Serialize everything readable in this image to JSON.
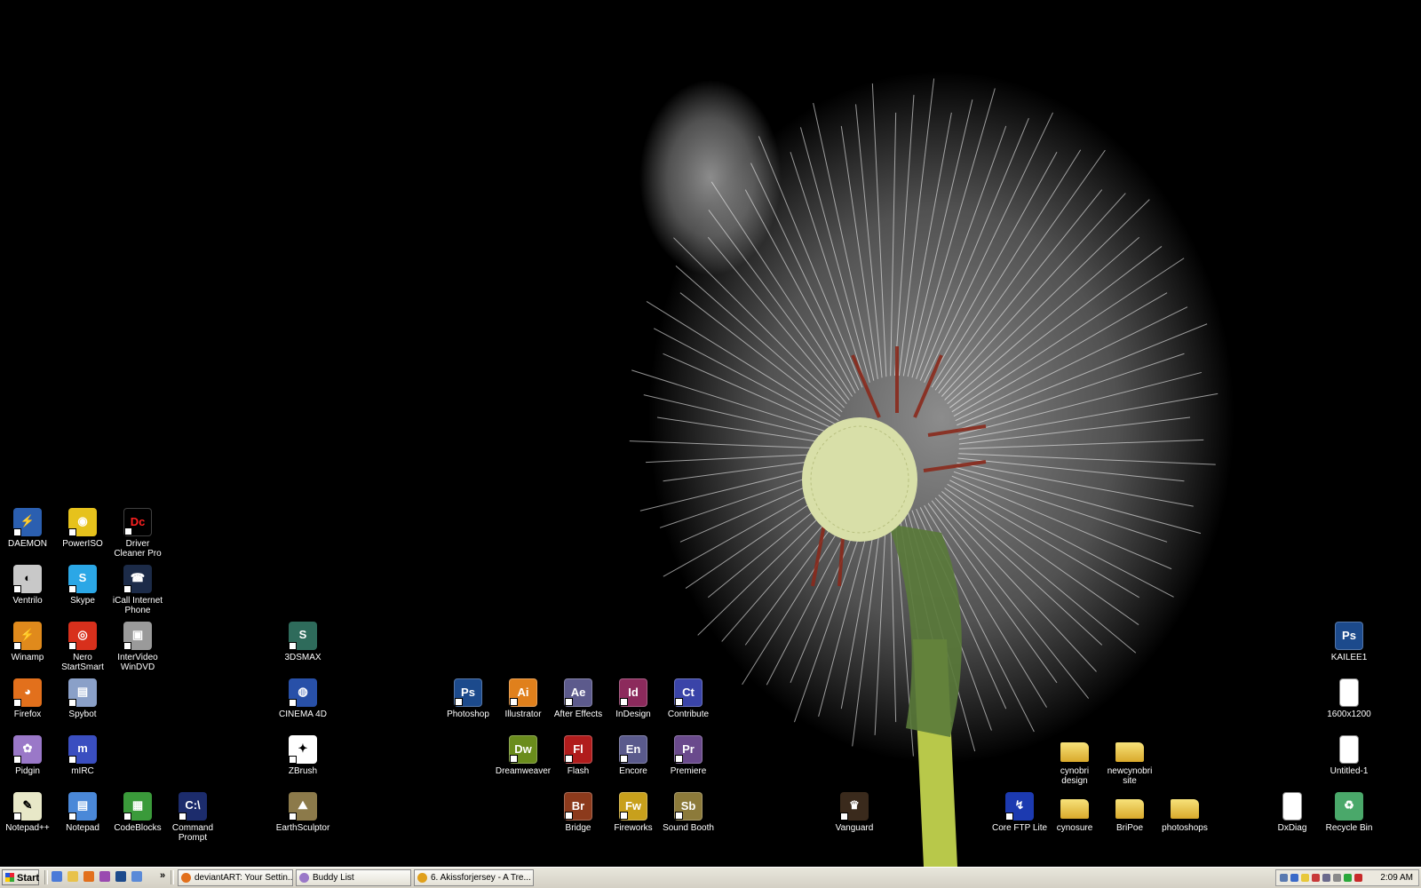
{
  "desktop": {
    "icons": [
      {
        "label": "DAEMON",
        "icon": "daemon-tools-icon",
        "bg": "#2b5fb0",
        "glyph": "⚡"
      },
      {
        "label": "PowerISO",
        "icon": "poweriso-icon",
        "bg": "#e6c21c",
        "glyph": "◉"
      },
      {
        "label": "Driver Cleaner Pro",
        "icon": "driver-cleaner-icon",
        "bg": "#000000",
        "glyph": "Dc"
      },
      {
        "label": "Ventrilo",
        "icon": "ventrilo-icon",
        "bg": "#c8c8c8",
        "glyph": "◐"
      },
      {
        "label": "Skype",
        "icon": "skype-icon",
        "bg": "#2ba7e6",
        "glyph": "S"
      },
      {
        "label": "iCall Internet Phone",
        "icon": "icall-icon",
        "bg": "#1c2b48",
        "glyph": "☎"
      },
      {
        "label": "Winamp",
        "icon": "winamp-icon",
        "bg": "#e08a1c",
        "glyph": "⚡"
      },
      {
        "label": "Nero StartSmart",
        "icon": "nero-icon",
        "bg": "#d8301c",
        "glyph": "◎"
      },
      {
        "label": "InterVideo WinDVD",
        "icon": "windvd-icon",
        "bg": "#9a9a9a",
        "glyph": "▣"
      },
      {
        "label": "3DSMAX",
        "icon": "3dsmax-icon",
        "bg": "#2e6b5b",
        "glyph": "S"
      },
      {
        "label": "Firefox",
        "icon": "firefox-icon",
        "bg": "#e2701c",
        "glyph": "◕"
      },
      {
        "label": "Spybot",
        "icon": "spybot-icon",
        "bg": "#8aa0c8",
        "glyph": "▤"
      },
      {
        "label": "CINEMA 4D",
        "icon": "cinema4d-icon",
        "bg": "#2850a8",
        "glyph": "◍"
      },
      {
        "label": "Pidgin",
        "icon": "pidgin-icon",
        "bg": "#9a78c8",
        "glyph": "✿"
      },
      {
        "label": "mIRC",
        "icon": "mirc-icon",
        "bg": "#3a4ec0",
        "glyph": "m"
      },
      {
        "label": "ZBrush",
        "icon": "zbrush-icon",
        "bg": "#ffffff",
        "glyph": "✦"
      },
      {
        "label": "Photoshop",
        "icon": "photoshop-icon",
        "bg": "#1c4a8c",
        "glyph": "Ps"
      },
      {
        "label": "Illustrator",
        "icon": "illustrator-icon",
        "bg": "#e0801c",
        "glyph": "Ai"
      },
      {
        "label": "After Effects",
        "icon": "after-effects-icon",
        "bg": "#5c5a8c",
        "glyph": "Ae"
      },
      {
        "label": "InDesign",
        "icon": "indesign-icon",
        "bg": "#8c2a5c",
        "glyph": "Id"
      },
      {
        "label": "Contribute",
        "icon": "contribute-icon",
        "bg": "#3a44a8",
        "glyph": "Ct"
      },
      {
        "label": "Dreamweaver",
        "icon": "dreamweaver-icon",
        "bg": "#6a8c1c",
        "glyph": "Dw"
      },
      {
        "label": "Flash",
        "icon": "flash-icon",
        "bg": "#b01c1c",
        "glyph": "Fl"
      },
      {
        "label": "Encore",
        "icon": "encore-icon",
        "bg": "#5a5a8c",
        "glyph": "En"
      },
      {
        "label": "Premiere",
        "icon": "premiere-icon",
        "bg": "#6a4a8c",
        "glyph": "Pr"
      },
      {
        "label": "Notepad++",
        "icon": "notepadpp-icon",
        "bg": "#e8e8c8",
        "glyph": "✎"
      },
      {
        "label": "Notepad",
        "icon": "notepad-icon",
        "bg": "#4a88d8",
        "glyph": "▤"
      },
      {
        "label": "CodeBlocks",
        "icon": "codeblocks-icon",
        "bg": "#3a9a3a",
        "glyph": "▦"
      },
      {
        "label": "Command Prompt",
        "icon": "command-prompt-icon",
        "bg": "#1c2c6c",
        "glyph": "C:\\"
      },
      {
        "label": "EarthSculptor",
        "icon": "earthsculptor-icon",
        "bg": "#8c7a4a",
        "glyph": "⛰"
      },
      {
        "label": "Bridge",
        "icon": "bridge-icon",
        "bg": "#8c3a1c",
        "glyph": "Br"
      },
      {
        "label": "Fireworks",
        "icon": "fireworks-icon",
        "bg": "#c8a01c",
        "glyph": "Fw"
      },
      {
        "label": "Sound Booth",
        "icon": "soundbooth-icon",
        "bg": "#8c7a3a",
        "glyph": "Sb"
      },
      {
        "label": "Vanguard",
        "icon": "vanguard-icon",
        "bg": "#3a2a1c",
        "glyph": "♛"
      },
      {
        "label": "Core FTP Lite",
        "icon": "coreftp-icon",
        "bg": "#1c3ab0",
        "glyph": "↯"
      },
      {
        "label": "cynobri design",
        "icon": "folder-icon",
        "type": "folder"
      },
      {
        "label": "newcynobri site",
        "icon": "folder-icon",
        "type": "folder"
      },
      {
        "label": "cynosure",
        "icon": "folder-icon",
        "type": "folder"
      },
      {
        "label": "BriPoe",
        "icon": "folder-icon",
        "type": "folder"
      },
      {
        "label": "photoshops",
        "icon": "folder-icon",
        "type": "folder"
      },
      {
        "label": "KAILEE1",
        "icon": "psd-file-icon",
        "bg": "#1c4a8c",
        "glyph": "Ps"
      },
      {
        "label": "1600x1200",
        "icon": "image-file-icon",
        "type": "doc"
      },
      {
        "label": "Untitled-1",
        "icon": "image-file-icon",
        "type": "doc"
      },
      {
        "label": "DxDiag",
        "icon": "text-file-icon",
        "type": "doc"
      },
      {
        "label": "Recycle Bin",
        "icon": "recycle-bin-icon",
        "bg": "#4aa86a",
        "glyph": "♻"
      }
    ]
  },
  "taskbar": {
    "start_label": "Start",
    "quick_launch": [
      {
        "icon": "show-desktop-icon",
        "color": "#4a7ad8"
      },
      {
        "icon": "explorer-icon",
        "color": "#e8c24a"
      },
      {
        "icon": "firefox-icon",
        "color": "#e2701c"
      },
      {
        "icon": "media-icon",
        "color": "#9a4ab0"
      },
      {
        "icon": "photoshop-icon",
        "color": "#1c4a8c"
      },
      {
        "icon": "window-icon",
        "color": "#5a8ad8"
      }
    ],
    "chevron": "»",
    "tasks": [
      {
        "label": "deviantART: Your Settin...",
        "icon": "firefox-icon",
        "color": "#e2701c"
      },
      {
        "label": "Buddy List",
        "icon": "pidgin-icon",
        "color": "#9a78c8"
      },
      {
        "label": "6. Akissforjersey - A Tre...",
        "icon": "winamp-icon",
        "color": "#e0a01c"
      }
    ],
    "tray_icons": [
      {
        "icon": "network-icon",
        "color": "#5a7ab0"
      },
      {
        "icon": "display-icon",
        "color": "#3a6ac8"
      },
      {
        "icon": "shield-icon",
        "color": "#e8c83a"
      },
      {
        "icon": "antivirus-icon",
        "color": "#c83a3a"
      },
      {
        "icon": "windvd-icon",
        "color": "#6a6a8c"
      },
      {
        "icon": "volume-icon",
        "color": "#8a8a8a"
      },
      {
        "icon": "wireless-icon",
        "color": "#2aa83a"
      },
      {
        "icon": "security-icon",
        "color": "#c82a2a"
      }
    ],
    "clock": "2:09 AM"
  }
}
